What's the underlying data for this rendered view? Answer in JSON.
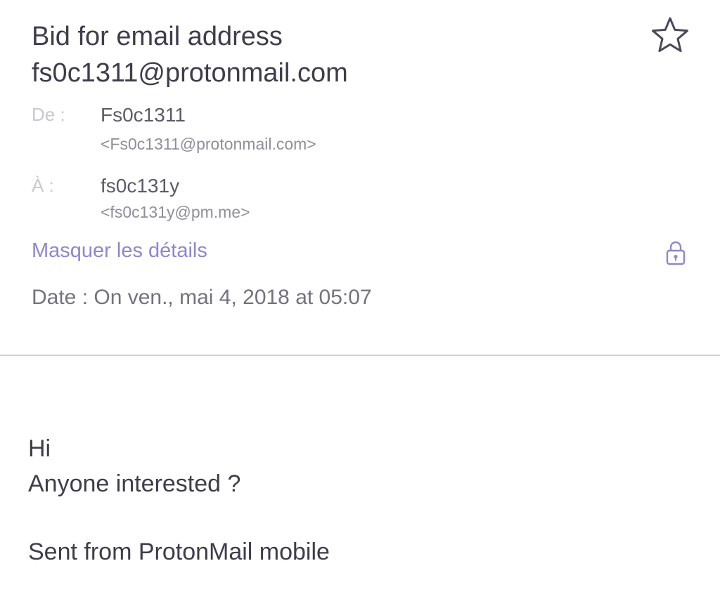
{
  "email": {
    "subject_line1": "Bid for email address",
    "subject_line2": "fs0c1311@protonmail.com",
    "starred": false,
    "from": {
      "label": "De :",
      "name": "Fs0c1311",
      "address": "<Fs0c1311@protonmail.com>"
    },
    "to": {
      "label": "À :",
      "name": "fs0c131y",
      "address": "<fs0c131y@pm.me>"
    },
    "hide_details_label": "Masquer les détails",
    "date_line": "Date : On ven., mai 4, 2018 at 05:07",
    "body": {
      "line1": "Hi",
      "line2": "Anyone interested ?",
      "signature": "Sent from ProtonMail mobile"
    }
  },
  "colors": {
    "accent": "#8d87cf",
    "text_dark": "#3e3d4b",
    "text_muted": "#8f8e9a",
    "divider": "#d3d2d9"
  },
  "icons": {
    "star": "star-outline-icon",
    "lock": "lock-icon"
  }
}
